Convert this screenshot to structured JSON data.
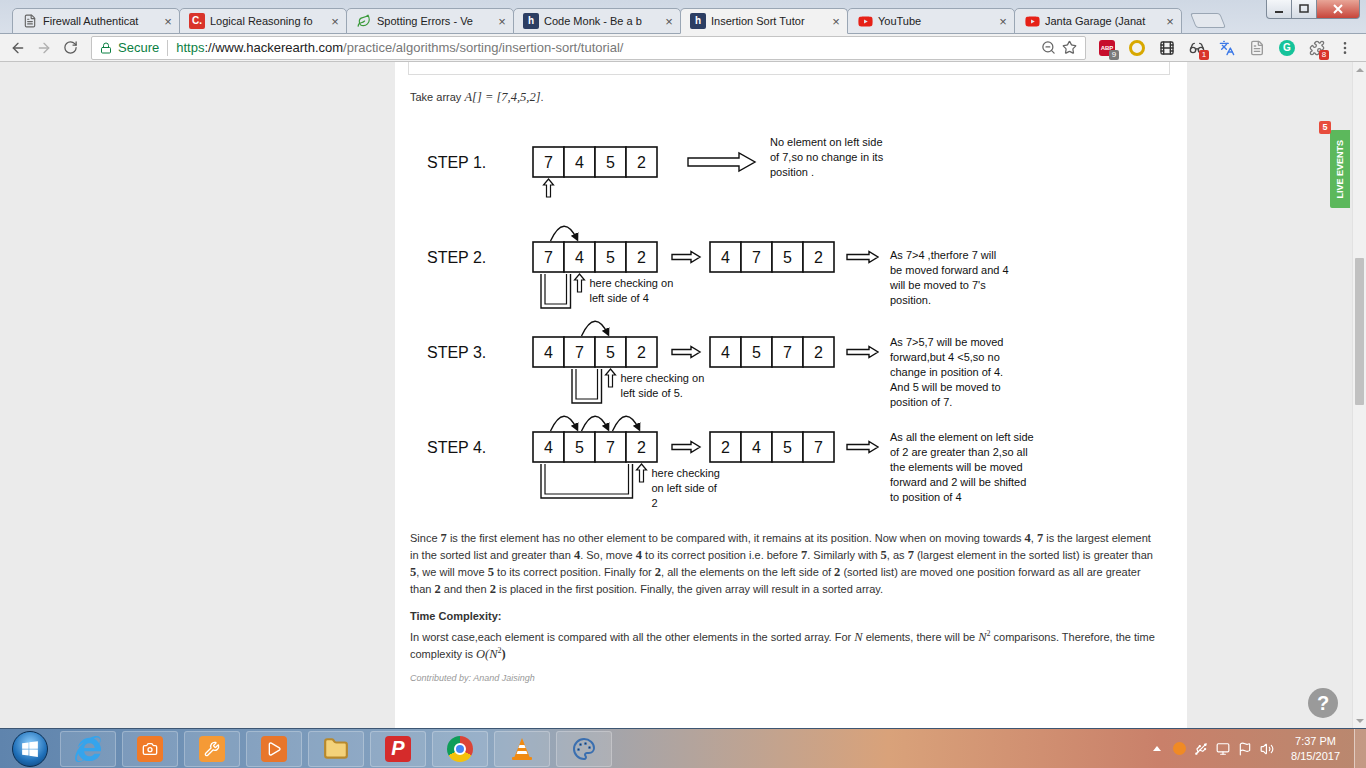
{
  "browser": {
    "tabs": [
      {
        "label": "Firewall Authenticat",
        "selected": false,
        "icon": "page"
      },
      {
        "label": "Logical Reasoning fo",
        "selected": false,
        "icon": "letter",
        "icon_text": "C.",
        "color": "#d9342b"
      },
      {
        "label": "Spotting Errors - Ve",
        "selected": false,
        "icon": "leaf",
        "color": "#3a9a3a"
      },
      {
        "label": "Code Monk - Be a b",
        "selected": false,
        "icon": "letter",
        "icon_text": "h",
        "color": "#2c3e63"
      },
      {
        "label": "Insertion Sort Tutor",
        "selected": true,
        "icon": "letter",
        "icon_text": "h",
        "color": "#2c3e63"
      },
      {
        "label": "YouTube",
        "selected": false,
        "icon": "youtube",
        "color": "#e62117"
      },
      {
        "label": "Janta Garage (Janat",
        "selected": false,
        "icon": "youtube",
        "color": "#e62117"
      }
    ],
    "tab_close": "×",
    "secure_label": "Secure",
    "url": [
      {
        "t": "https",
        "kind": "secure"
      },
      {
        "t": "://www.hackerearth.com",
        "kind": "host"
      },
      {
        "t": "/practice/algorithms/sorting/insertion-sort/tutorial/",
        "kind": "path"
      }
    ],
    "bookmarked": false,
    "extensions": [
      {
        "kind": "abp",
        "text": "ABP",
        "badge": "9",
        "badge_color": "#7a7a7a"
      },
      {
        "kind": "coin"
      },
      {
        "kind": "film"
      },
      {
        "kind": "spy",
        "badge": "1",
        "badge_color": "#d9342b"
      },
      {
        "kind": "translate"
      },
      {
        "kind": "pdf"
      },
      {
        "kind": "grammarly",
        "text": "G"
      },
      {
        "kind": "puzzle",
        "badge": "8",
        "badge_color": "#d9342b"
      }
    ]
  },
  "page": {
    "intro": [
      {
        "t": "Take array ",
        "math": false
      },
      {
        "t": "A[] = [7,4,5,2]",
        "math": true
      },
      {
        "t": ".",
        "math": false
      }
    ],
    "steps": [
      {
        "label": "STEP 1.",
        "before": [
          "7",
          "4",
          "5",
          "2"
        ],
        "pointer": 0,
        "check_from": null,
        "moves": [],
        "after": null,
        "annotation": [],
        "note": [
          "No element on left side",
          "of 7,so no change in its",
          "position ."
        ]
      },
      {
        "label": "STEP 2.",
        "before": [
          "7",
          "4",
          "5",
          "2"
        ],
        "pointer": 1,
        "check_from": 0,
        "moves": [
          [
            0,
            1
          ]
        ],
        "after": [
          "4",
          "7",
          "5",
          "2"
        ],
        "annotation": [
          "here checking on",
          "left side of 4"
        ],
        "note": [
          "As 7>4 ,therfore 7 will",
          "be moved forward and 4",
          "will be moved to 7's",
          "position."
        ]
      },
      {
        "label": "STEP 3.",
        "before": [
          "4",
          "7",
          "5",
          "2"
        ],
        "pointer": 2,
        "check_from": 1,
        "moves": [
          [
            1,
            2
          ]
        ],
        "after": [
          "4",
          "5",
          "7",
          "2"
        ],
        "annotation": [
          "here checking on",
          "left side of 5."
        ],
        "note": [
          "As 7>5,7 will be moved",
          "forward,but 4 <5,so no",
          "change in position of 4.",
          "And 5 will be moved to",
          "position of 7."
        ]
      },
      {
        "label": "STEP 4.",
        "before": [
          "4",
          "5",
          "7",
          "2"
        ],
        "pointer": 3,
        "check_from": 0,
        "moves": [
          [
            0,
            1
          ],
          [
            1,
            2
          ],
          [
            2,
            3
          ]
        ],
        "after": [
          "2",
          "4",
          "5",
          "7"
        ],
        "annotation": [
          "here checking",
          "on left side of",
          "2"
        ],
        "note": [
          "As all the element on left side",
          "of 2 are greater than 2,so all",
          "the elements will be moved",
          "forward and 2 will be shifted",
          "to position of 4"
        ]
      }
    ],
    "explanation": [
      {
        "t": "Since ",
        "math": false
      },
      {
        "t": "7",
        "math": true
      },
      {
        "t": " is the first element has no other element to be compared with, it remains at its position. Now when on moving towards ",
        "math": false
      },
      {
        "t": "4",
        "math": true
      },
      {
        "t": ", ",
        "math": false
      },
      {
        "t": "7",
        "math": true
      },
      {
        "t": " is the largest element in the sorted list and greater than ",
        "math": false
      },
      {
        "t": "4",
        "math": true
      },
      {
        "t": ". So, move ",
        "math": false
      },
      {
        "t": "4",
        "math": true
      },
      {
        "t": " to its correct position i.e. before ",
        "math": false
      },
      {
        "t": "7",
        "math": true
      },
      {
        "t": ". Similarly with ",
        "math": false
      },
      {
        "t": "5",
        "math": true
      },
      {
        "t": ", as ",
        "math": false
      },
      {
        "t": "7",
        "math": true
      },
      {
        "t": " (largest element in the sorted list) is greater than ",
        "math": false
      },
      {
        "t": "5",
        "math": true
      },
      {
        "t": ", we will move ",
        "math": false
      },
      {
        "t": "5",
        "math": true
      },
      {
        "t": " to its correct position. Finally for ",
        "math": false
      },
      {
        "t": "2",
        "math": true
      },
      {
        "t": ", all the elements on the left side of ",
        "math": false
      },
      {
        "t": "2",
        "math": true
      },
      {
        "t": " (sorted list) are moved one position forward as all are greater than ",
        "math": false
      },
      {
        "t": "2",
        "math": true
      },
      {
        "t": " and then ",
        "math": false
      },
      {
        "t": "2",
        "math": true
      },
      {
        "t": " is placed in the first position. Finally, the given array will result in a sorted array.",
        "math": false
      }
    ],
    "heading": "Time Complexity:",
    "complexity": [
      {
        "t": "In worst case,each element is compared with all the other elements in the sorted array. For ",
        "math": false
      },
      {
        "t": "N",
        "math": true
      },
      {
        "t": " elements, there will be ",
        "math": false
      },
      {
        "t": "N",
        "math": true,
        "sup": "2"
      },
      {
        "t": " comparisons. Therefore, the time complexity is ",
        "math": false
      },
      {
        "t": "O(N",
        "math": true,
        "sup": "2"
      },
      {
        "t": ")",
        "math": true
      }
    ],
    "contributor": "Contributed by: Anand Jaisingh",
    "live_events": {
      "label": "LIVE EVENTS",
      "badge": "5"
    },
    "help": "?",
    "scrollbar": {
      "offset": 0.285,
      "size": 0.231
    }
  },
  "taskbar": {
    "apps": [
      {
        "kind": "ie"
      },
      {
        "kind": "camera"
      },
      {
        "kind": "tool"
      },
      {
        "kind": "video"
      },
      {
        "kind": "folder"
      },
      {
        "kind": "letter",
        "text": "P"
      },
      {
        "kind": "chrome"
      },
      {
        "kind": "vlc"
      },
      {
        "kind": "paint"
      }
    ],
    "tray": [
      {
        "kind": "avast"
      },
      {
        "kind": "usb"
      },
      {
        "kind": "network"
      },
      {
        "kind": "flag"
      },
      {
        "kind": "volume"
      }
    ],
    "clock": {
      "time": "7:37 PM",
      "date": "8/15/2017"
    }
  }
}
